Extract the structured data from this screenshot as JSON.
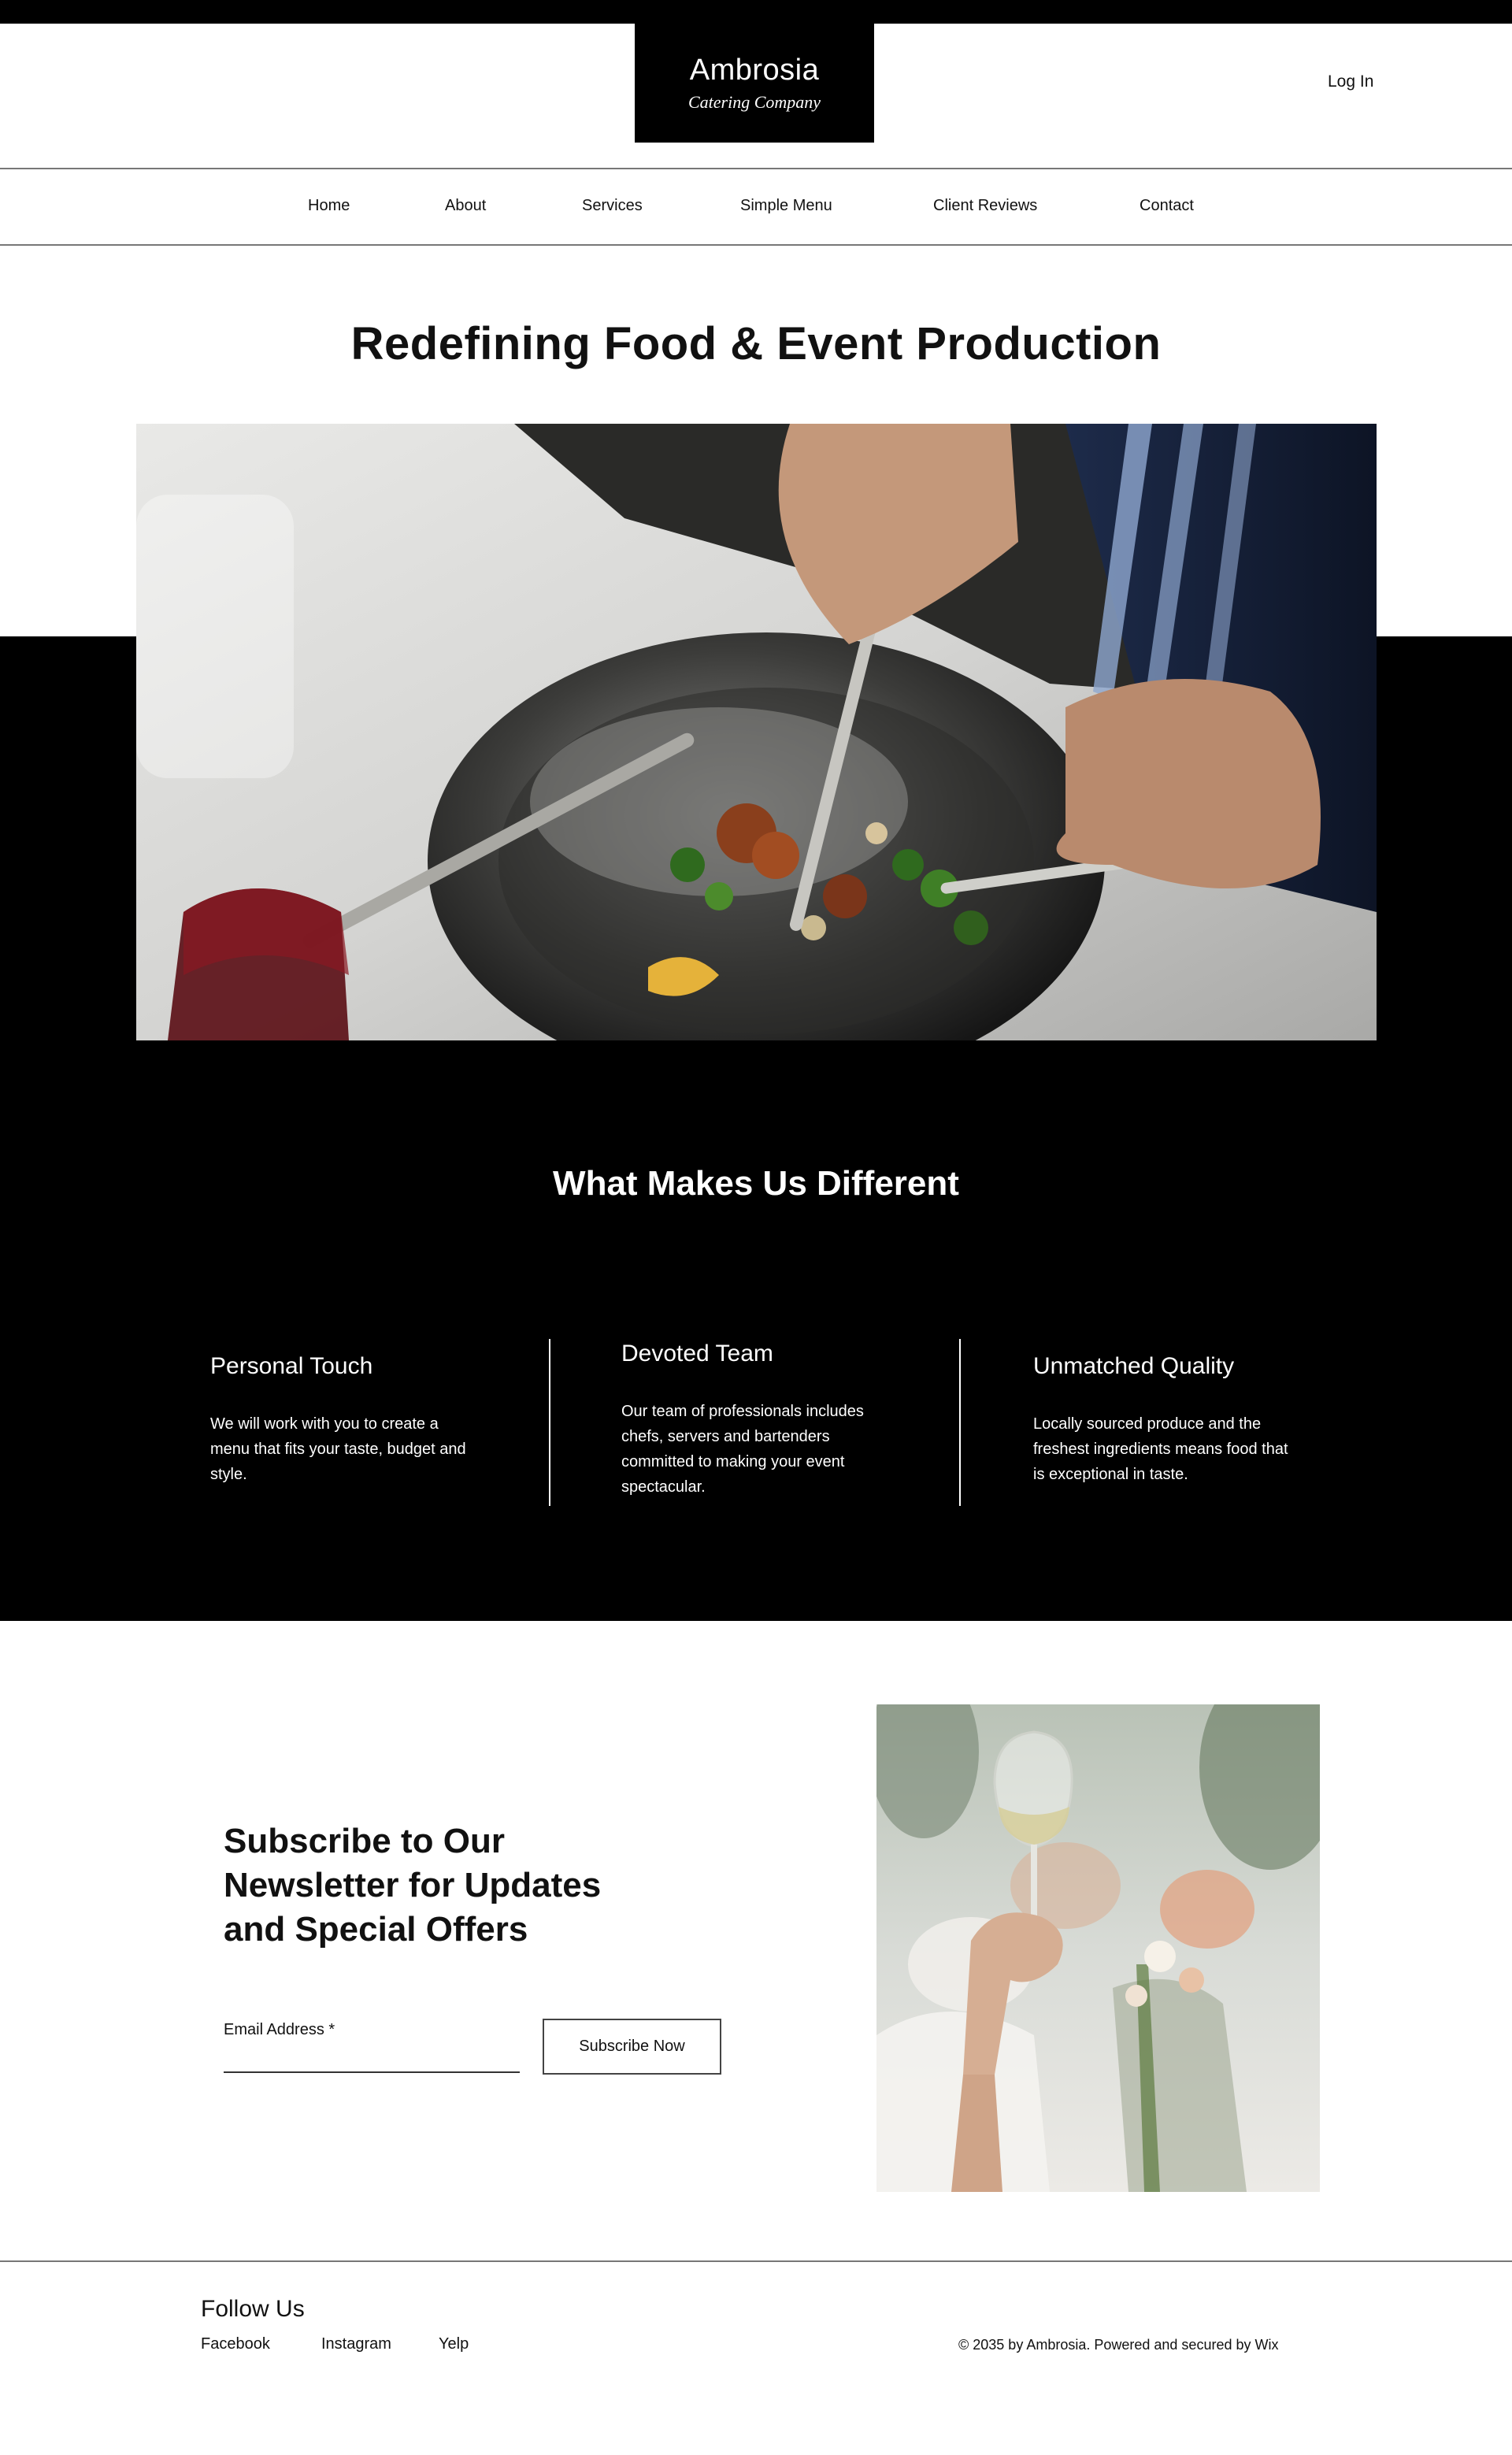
{
  "brand": {
    "name": "Ambrosia",
    "tagline": "Catering Company"
  },
  "header": {
    "login_label": "Log In"
  },
  "nav": {
    "items": [
      {
        "label": "Home"
      },
      {
        "label": "About"
      },
      {
        "label": "Services"
      },
      {
        "label": "Simple Menu"
      },
      {
        "label": "Client Reviews"
      },
      {
        "label": "Contact"
      }
    ]
  },
  "hero": {
    "title": "Redefining Food & Event Production"
  },
  "features": {
    "title": "What Makes Us Different",
    "items": [
      {
        "title": "Personal Touch",
        "text": "We will work with you to create a menu that fits your taste, budget and style."
      },
      {
        "title": "Devoted Team",
        "text": "Our team of professionals includes chefs, servers and bartenders committed to making your event spectacular."
      },
      {
        "title": "Unmatched Quality",
        "text": "Locally sourced produce and the freshest ingredients means food that is exceptional in taste."
      }
    ]
  },
  "newsletter": {
    "title": "Subscribe to Our Newsletter for Updates and Special Offers",
    "email_label": "Email Address *",
    "email_value": "",
    "button_label": "Subscribe Now"
  },
  "footer": {
    "follow_title": "Follow Us",
    "social": [
      {
        "label": "Facebook"
      },
      {
        "label": "Instagram"
      },
      {
        "label": "Yelp"
      }
    ],
    "copyright": "© 2035 by Ambrosia. Powered and secured by Wix"
  },
  "colors": {
    "background": "#ffffff",
    "band": "#000000",
    "text": "#111111",
    "inverse_text": "#ffffff"
  }
}
